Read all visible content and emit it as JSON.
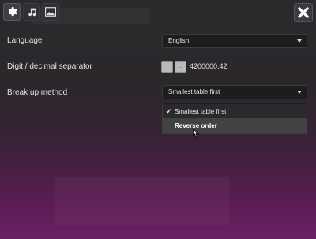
{
  "tabs": [
    {
      "icon": "gear-icon",
      "active": true
    },
    {
      "icon": "music-note-icon",
      "active": false
    },
    {
      "icon": "image-icon",
      "active": false
    }
  ],
  "close_icon": "close-icon",
  "settings": {
    "language": {
      "label": "Language",
      "value": "English"
    },
    "separator": {
      "label": "Digit / decimal separator",
      "digit": "",
      "decimal": ".",
      "sample": "4200000.42"
    },
    "break_up": {
      "label": "Break up method",
      "value": "Smallest table first",
      "options": [
        {
          "label": "Smallest table first",
          "selected": true
        },
        {
          "label": "Reverse order",
          "selected": false,
          "hovered": true
        }
      ]
    }
  },
  "colors": {
    "panel_top": "#2a2b2d",
    "panel_bottom": "#6a2063",
    "hover": "#424242"
  }
}
